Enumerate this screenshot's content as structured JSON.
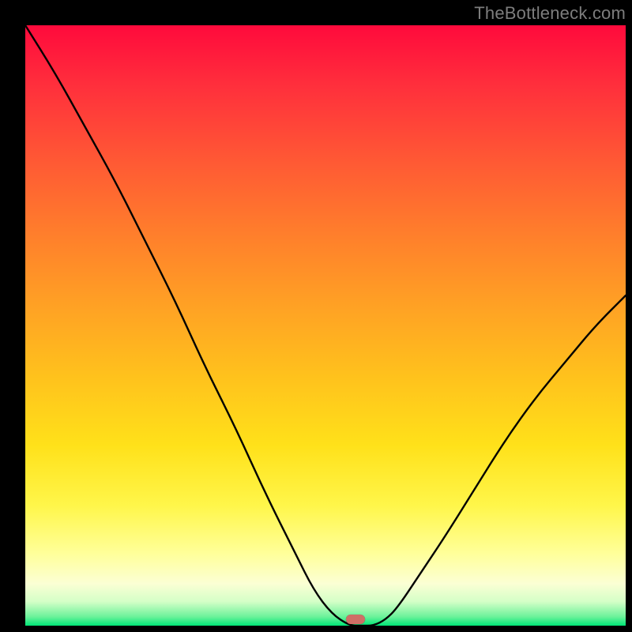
{
  "watermark": "TheBottleneck.com",
  "colors": {
    "background": "#000000",
    "curve_stroke": "#000000",
    "marker_fill": "#cf6f66",
    "gradient_stops": [
      "#ff0a3c",
      "#ff2f3c",
      "#ff5a34",
      "#ff7c2c",
      "#ffa224",
      "#ffc31c",
      "#ffe11a",
      "#fff64a",
      "#ffff9a",
      "#fbffd4",
      "#d4ffc7",
      "#6cf29a",
      "#00e676"
    ]
  },
  "chart_data": {
    "type": "line",
    "title": "",
    "xlabel": "",
    "ylabel": "",
    "xlim": [
      0,
      100
    ],
    "ylim": [
      0,
      100
    ],
    "series": [
      {
        "name": "bottleneck-curve",
        "x": [
          0,
          5,
          10,
          15,
          20,
          25,
          30,
          35,
          40,
          45,
          48,
          51,
          54,
          56,
          58,
          60,
          62,
          66,
          70,
          75,
          80,
          85,
          90,
          95,
          100
        ],
        "y": [
          100,
          92,
          83,
          74,
          64,
          54,
          43,
          33,
          22,
          12,
          6,
          2,
          0,
          0,
          0,
          1,
          3,
          9,
          15,
          23,
          31,
          38,
          44,
          50,
          55
        ]
      }
    ],
    "annotations": [
      {
        "name": "optimal-marker",
        "x": 55,
        "y": 1
      }
    ]
  }
}
